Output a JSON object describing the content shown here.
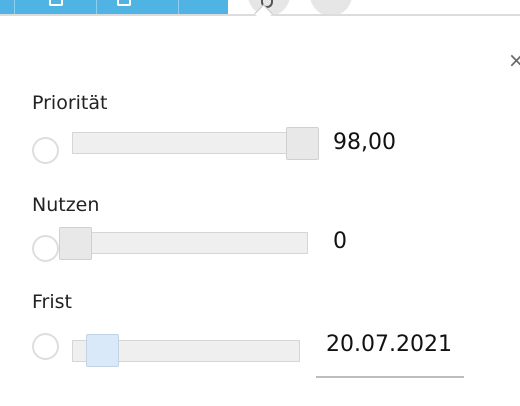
{
  "dialog": {
    "close_label": "×"
  },
  "fields": [
    {
      "label": "Priorität",
      "value": "98,00",
      "level_percent": 98
    },
    {
      "label": "Nutzen",
      "value": "0",
      "level_percent": 0
    },
    {
      "label": "Frist",
      "value": "20.07.2021"
    }
  ]
}
